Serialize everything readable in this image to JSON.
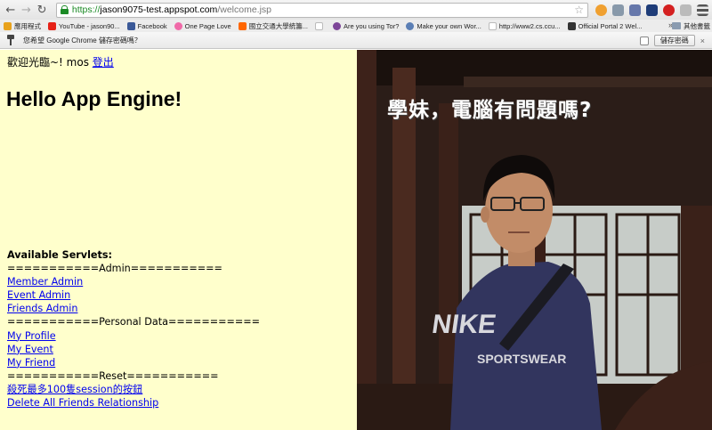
{
  "browser": {
    "url_scheme": "https://",
    "url_host": "jason9075-test.appspot.com",
    "url_path": "/welcome.jsp",
    "bookmarks": [
      {
        "label": "應用程式",
        "color": "#e8a21c"
      },
      {
        "label": "YouTube - jason90...",
        "color": "#e62117"
      },
      {
        "label": "Facebook",
        "color": "#3b5998"
      },
      {
        "label": "One Page Love",
        "color": "#f06aa8"
      },
      {
        "label": "國立交通大學統籌...",
        "color": "#ff6600"
      },
      {
        "label": "",
        "color": "#dddddd"
      },
      {
        "label": "Are you using Tor?",
        "color": "#7d4698"
      },
      {
        "label": "Make your own Wor...",
        "color": "#5b7fb5"
      },
      {
        "label": "http://www2.cs.ccu...",
        "color": "#dddddd"
      },
      {
        "label": "Official Portal 2 Wel...",
        "color": "#333333"
      }
    ],
    "bookmarks_more": "»",
    "other_bookmarks": "其他書籤",
    "infobar_text": "您希望 Google Chrome 儲存密碼嗎？",
    "save_password_label": "儲存密碼",
    "close_label": "×"
  },
  "page": {
    "welcome_text": "歡迎光臨~! mos ",
    "logout_label": "登出",
    "title": "Hello App Engine!",
    "servlets_heading": "Available Servlets:",
    "admin_separator": "===========Admin===========",
    "admin_links": [
      "Member Admin",
      "Event Admin",
      "Friends Admin"
    ],
    "personal_separator": "===========Personal Data===========",
    "personal_links": [
      "My Profile",
      "My Event",
      "My Friend"
    ],
    "reset_separator": "===========Reset===========",
    "reset_links": [
      "殺死最多100隻session的按鈕",
      "Delete All Friends Relationship"
    ],
    "photo_caption": "學妹，電腦有問題嗎?"
  },
  "colors": {
    "page_background": "#ffffcc",
    "link": "#0000ee",
    "secure_green": "#1b8a25"
  }
}
